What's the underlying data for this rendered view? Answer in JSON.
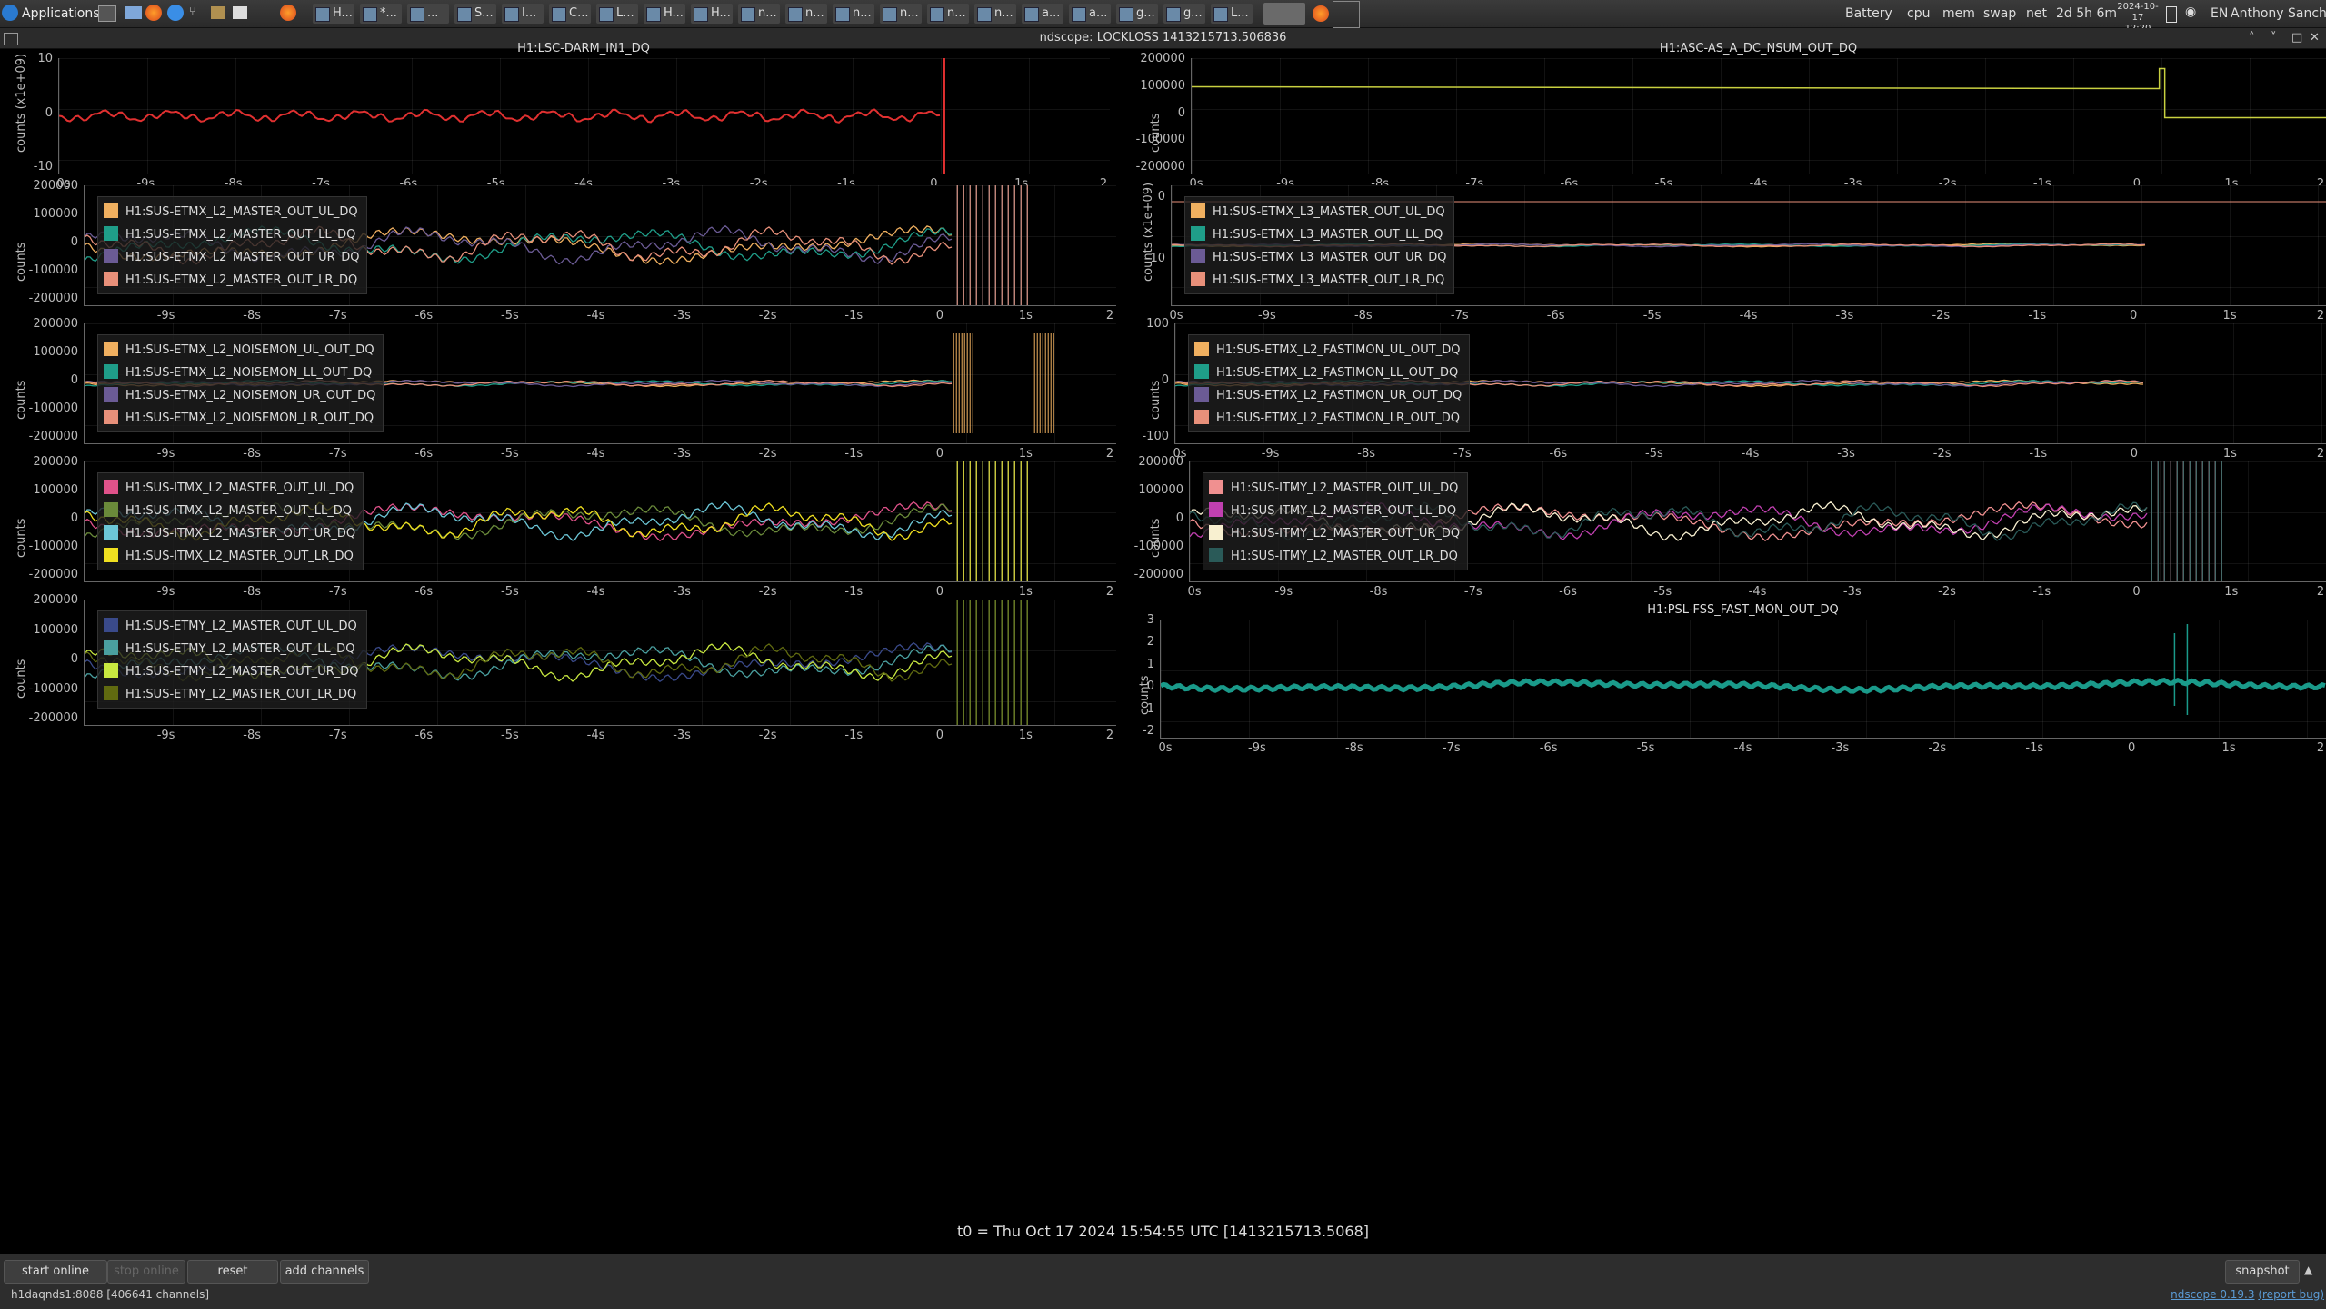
{
  "taskbar": {
    "apps_label": "Applications",
    "windows": [
      {
        "label": "H..."
      },
      {
        "label": "*..."
      },
      {
        "label": "..."
      },
      {
        "label": "S..."
      },
      {
        "label": "I..."
      },
      {
        "label": "C..."
      },
      {
        "label": "L..."
      },
      {
        "label": "H..."
      },
      {
        "label": "H..."
      },
      {
        "label": "n..."
      },
      {
        "label": "n..."
      },
      {
        "label": "n..."
      },
      {
        "label": "n..."
      },
      {
        "label": "n..."
      },
      {
        "label": "n..."
      },
      {
        "label": "a..."
      },
      {
        "label": "a..."
      },
      {
        "label": "g..."
      },
      {
        "label": "g..."
      },
      {
        "label": "L..."
      }
    ],
    "tray": {
      "battery": "Battery",
      "cpu": "cpu",
      "mem": "mem",
      "swap": "swap",
      "net": "net",
      "uptime": "2d 5h 6m",
      "date": "2024-10-17",
      "time": "12:20",
      "lang": "EN",
      "user": "Anthony Sanchez"
    }
  },
  "window": {
    "title": "ndscope: LOCKLOSS 1413215713.506836"
  },
  "x_ticks": [
    "0s",
    "-9s",
    "-8s",
    "-7s",
    "-6s",
    "-5s",
    "-4s",
    "-3s",
    "-2s",
    "-1s",
    "0",
    "1s",
    "2"
  ],
  "x_ticks_short": [
    "-9s",
    "-8s",
    "-7s",
    "-6s",
    "-5s",
    "-4s",
    "-3s",
    "-2s",
    "-1s",
    "0",
    "1s",
    "2"
  ],
  "plots": [
    {
      "id": "darm",
      "title": "H1:LSC-DARM_IN1_DQ",
      "ylabel": "counts (x1e+09)",
      "yticks": [
        "10",
        "0",
        "-10"
      ],
      "legend": []
    },
    {
      "id": "asc",
      "title": "H1:ASC-AS_A_DC_NSUM_OUT_DQ",
      "ylabel": "counts",
      "yticks": [
        "200000",
        "100000",
        "0",
        "-100000",
        "-200000"
      ],
      "legend": []
    },
    {
      "id": "etmx_master",
      "title": "",
      "ylabel": "counts",
      "yticks": [
        "200000",
        "100000",
        "0",
        "-100000",
        "-200000"
      ],
      "legend": [
        {
          "label": "H1:SUS-ETMX_L2_MASTER_OUT_UL_DQ",
          "color": "#f0b060"
        },
        {
          "label": "H1:SUS-ETMX_L2_MASTER_OUT_LL_DQ",
          "color": "#1f9e89"
        },
        {
          "label": "H1:SUS-ETMX_L2_MASTER_OUT_UR_DQ",
          "color": "#6b5b95"
        },
        {
          "label": "H1:SUS-ETMX_L2_MASTER_OUT_LR_DQ",
          "color": "#e8907a"
        }
      ]
    },
    {
      "id": "etmx_l3",
      "title": "",
      "ylabel": "counts (x1e+09)",
      "yticks": [
        "0",
        "-10"
      ],
      "legend": [
        {
          "label": "H1:SUS-ETMX_L3_MASTER_OUT_UL_DQ",
          "color": "#f0b060"
        },
        {
          "label": "H1:SUS-ETMX_L3_MASTER_OUT_LL_DQ",
          "color": "#1f9e89"
        },
        {
          "label": "H1:SUS-ETMX_L3_MASTER_OUT_UR_DQ",
          "color": "#6b5b95"
        },
        {
          "label": "H1:SUS-ETMX_L3_MASTER_OUT_LR_DQ",
          "color": "#e8907a"
        }
      ]
    },
    {
      "id": "etmx_noisemon",
      "title": "",
      "ylabel": "counts",
      "yticks": [
        "200000",
        "100000",
        "0",
        "-100000",
        "-200000"
      ],
      "legend": [
        {
          "label": "H1:SUS-ETMX_L2_NOISEMON_UL_OUT_DQ",
          "color": "#f0b060"
        },
        {
          "label": "H1:SUS-ETMX_L2_NOISEMON_LL_OUT_DQ",
          "color": "#1f9e89"
        },
        {
          "label": "H1:SUS-ETMX_L2_NOISEMON_UR_OUT_DQ",
          "color": "#6b5b95"
        },
        {
          "label": "H1:SUS-ETMX_L2_NOISEMON_LR_OUT_DQ",
          "color": "#e8907a"
        }
      ]
    },
    {
      "id": "etmx_fastimon",
      "title": "",
      "ylabel": "counts",
      "yticks": [
        "100",
        "0",
        "-100"
      ],
      "legend": [
        {
          "label": "H1:SUS-ETMX_L2_FASTIMON_UL_OUT_DQ",
          "color": "#f0b060"
        },
        {
          "label": "H1:SUS-ETMX_L2_FASTIMON_LL_OUT_DQ",
          "color": "#1f9e89"
        },
        {
          "label": "H1:SUS-ETMX_L2_FASTIMON_UR_OUT_DQ",
          "color": "#6b5b95"
        },
        {
          "label": "H1:SUS-ETMX_L2_FASTIMON_LR_OUT_DQ",
          "color": "#e8907a"
        }
      ]
    },
    {
      "id": "itmx",
      "title": "",
      "ylabel": "counts",
      "yticks": [
        "200000",
        "100000",
        "0",
        "-100000",
        "-200000"
      ],
      "legend": [
        {
          "label": "H1:SUS-ITMX_L2_MASTER_OUT_UL_DQ",
          "color": "#e0528a"
        },
        {
          "label": "H1:SUS-ITMX_L2_MASTER_OUT_LL_DQ",
          "color": "#6a8a3a"
        },
        {
          "label": "H1:SUS-ITMX_L2_MASTER_OUT_UR_DQ",
          "color": "#6cc6d6"
        },
        {
          "label": "H1:SUS-ITMX_L2_MASTER_OUT_LR_DQ",
          "color": "#f0e020"
        }
      ]
    },
    {
      "id": "itmy",
      "title": "",
      "ylabel": "counts",
      "yticks": [
        "200000",
        "100000",
        "0",
        "-100000",
        "-200000"
      ],
      "legend": [
        {
          "label": "H1:SUS-ITMY_L2_MASTER_OUT_UL_DQ",
          "color": "#f09090"
        },
        {
          "label": "H1:SUS-ITMY_L2_MASTER_OUT_LL_DQ",
          "color": "#c040b0"
        },
        {
          "label": "H1:SUS-ITMY_L2_MASTER_OUT_UR_DQ",
          "color": "#f8f0d0"
        },
        {
          "label": "H1:SUS-ITMY_L2_MASTER_OUT_LR_DQ",
          "color": "#2a5a58"
        }
      ]
    },
    {
      "id": "etmy",
      "title": "",
      "ylabel": "counts",
      "yticks": [
        "200000",
        "100000",
        "0",
        "-100000",
        "-200000"
      ],
      "legend": [
        {
          "label": "H1:SUS-ETMY_L2_MASTER_OUT_UL_DQ",
          "color": "#3a4a8a"
        },
        {
          "label": "H1:SUS-ETMY_L2_MASTER_OUT_LL_DQ",
          "color": "#4aa0a0"
        },
        {
          "label": "H1:SUS-ETMY_L2_MASTER_OUT_UR_DQ",
          "color": "#c8e840"
        },
        {
          "label": "H1:SUS-ETMY_L2_MASTER_OUT_LR_DQ",
          "color": "#606a10"
        }
      ]
    },
    {
      "id": "psl",
      "title": "H1:PSL-FSS_FAST_MON_OUT_DQ",
      "ylabel": "counts",
      "yticks": [
        "3",
        "2",
        "1",
        "0",
        "-1",
        "-2"
      ],
      "legend": []
    }
  ],
  "t0_label": "t0 = Thu Oct 17 2024 15:54:55 UTC [1413215713.5068]",
  "bottom": {
    "start_online": "start online",
    "stop_online": "stop online",
    "reset": "reset",
    "add_channels": "add channels",
    "snapshot": "snapshot",
    "status": "h1daqnds1:8088  [406641 channels]",
    "version_link": "ndscope 0.19.3",
    "report_bug": "(report bug)"
  },
  "colors": {
    "darm_trace": "#e03030",
    "asc_trace": "#c8d040",
    "psl_trace": "#1a9a8a"
  }
}
